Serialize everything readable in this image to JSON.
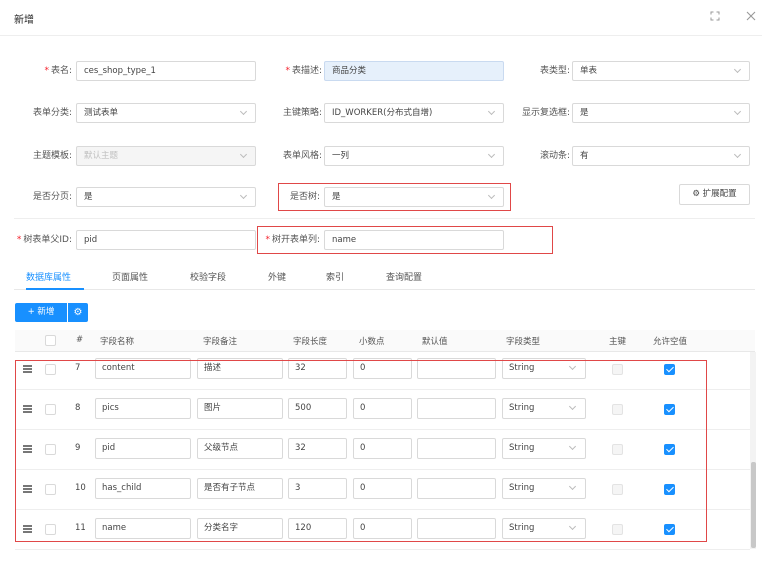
{
  "dialog": {
    "title": "新增"
  },
  "form": {
    "table_name_label": "表名:",
    "table_name_value": "ces_shop_type_1",
    "table_desc_label": "表描述:",
    "table_desc_value": "商品分类",
    "table_type_label": "表类型:",
    "table_type_value": "单表",
    "form_category_label": "表单分类:",
    "form_category_value": "测试表单",
    "pk_strategy_label": "主键策略:",
    "pk_strategy_value": "ID_WORKER(分布式自增)",
    "show_checkbox_label": "显示复选框:",
    "show_checkbox_value": "是",
    "theme_label": "主题模板:",
    "theme_value": "默认主题",
    "form_style_label": "表单风格:",
    "form_style_value": "一列",
    "scrollbar_label": "滚动条:",
    "scrollbar_value": "有",
    "paging_label": "是否分页:",
    "paging_value": "是",
    "is_tree_label": "是否树:",
    "is_tree_value": "是",
    "extend_config_label": "扩展配置",
    "tree_parent_id_label": "树表单父ID:",
    "tree_parent_id_value": "pid",
    "tree_expand_col_label": "树开表单列:",
    "tree_expand_col_value": "name"
  },
  "tabs": [
    "数据库属性",
    "页面属性",
    "校验字段",
    "外键",
    "索引",
    "查询配置"
  ],
  "toolbar": {
    "add_label": "新增"
  },
  "table": {
    "headers": [
      "#",
      "字段名称",
      "字段备注",
      "字段长度",
      "小数点",
      "默认值",
      "字段类型",
      "主键",
      "允许空值"
    ],
    "rows": [
      {
        "no": "7",
        "name": "content",
        "comment": "描述",
        "length": "32",
        "decimal": "0",
        "default": "",
        "type": "String",
        "pk": false,
        "nullable": true
      },
      {
        "no": "8",
        "name": "pics",
        "comment": "图片",
        "length": "500",
        "decimal": "0",
        "default": "",
        "type": "String",
        "pk": false,
        "nullable": true
      },
      {
        "no": "9",
        "name": "pid",
        "comment": "父级节点",
        "length": "32",
        "decimal": "0",
        "default": "",
        "type": "String",
        "pk": false,
        "nullable": true
      },
      {
        "no": "10",
        "name": "has_child",
        "comment": "是否有子节点",
        "length": "3",
        "decimal": "0",
        "default": "",
        "type": "String",
        "pk": false,
        "nullable": true
      },
      {
        "no": "11",
        "name": "name",
        "comment": "分类名字",
        "length": "120",
        "decimal": "0",
        "default": "",
        "type": "String",
        "pk": false,
        "nullable": true
      }
    ]
  },
  "colors": {
    "primary": "#1890ff",
    "highlight_border": "#e04848",
    "required": "#f5222d"
  }
}
